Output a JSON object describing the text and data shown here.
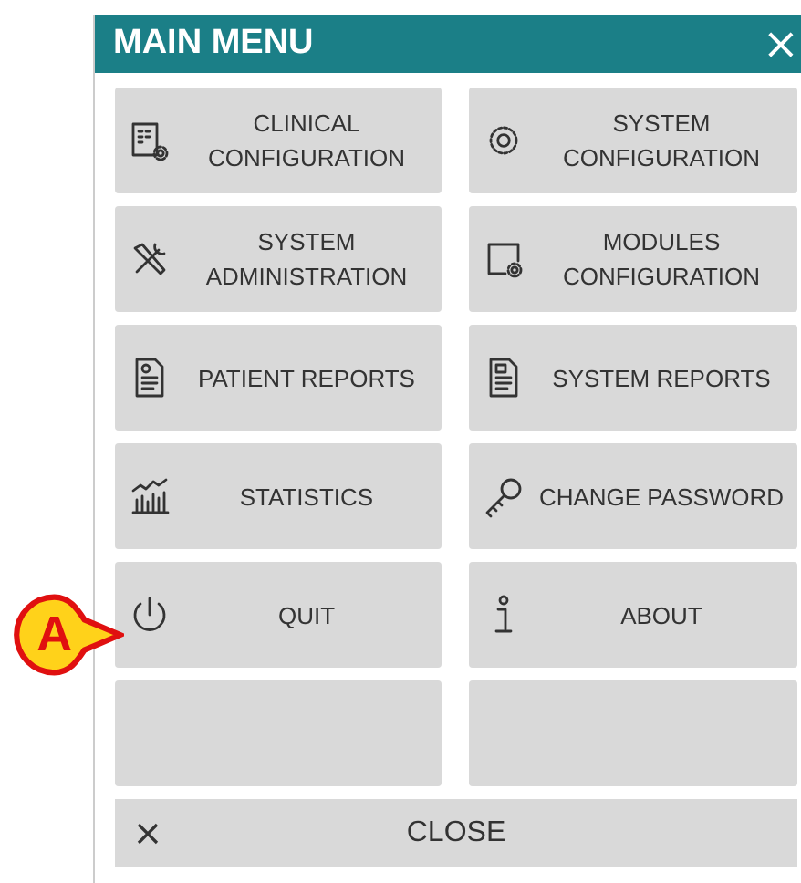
{
  "window": {
    "title": "MAIN MENU",
    "close_glyph": "×"
  },
  "menu_items": [
    {
      "kind": "action",
      "label": "CLINICAL CONFIGURATION"
    },
    {
      "kind": "action",
      "label": "SYSTEM CONFIGURATION"
    },
    {
      "kind": "action",
      "label": "SYSTEM ADMINISTRATION"
    },
    {
      "kind": "action",
      "label": "MODULES CONFIGURATION"
    },
    {
      "kind": "action",
      "label": "PATIENT REPORTS"
    },
    {
      "kind": "action",
      "label": "SYSTEM REPORTS"
    },
    {
      "kind": "action",
      "label": "STATISTICS"
    },
    {
      "kind": "action",
      "label": "CHANGE PASSWORD"
    },
    {
      "kind": "action",
      "label": "QUIT"
    },
    {
      "kind": "action",
      "label": "ABOUT"
    },
    {
      "kind": "blank"
    },
    {
      "kind": "blank"
    }
  ],
  "close_button": {
    "label": "CLOSE"
  },
  "callout": {
    "label": "A"
  }
}
